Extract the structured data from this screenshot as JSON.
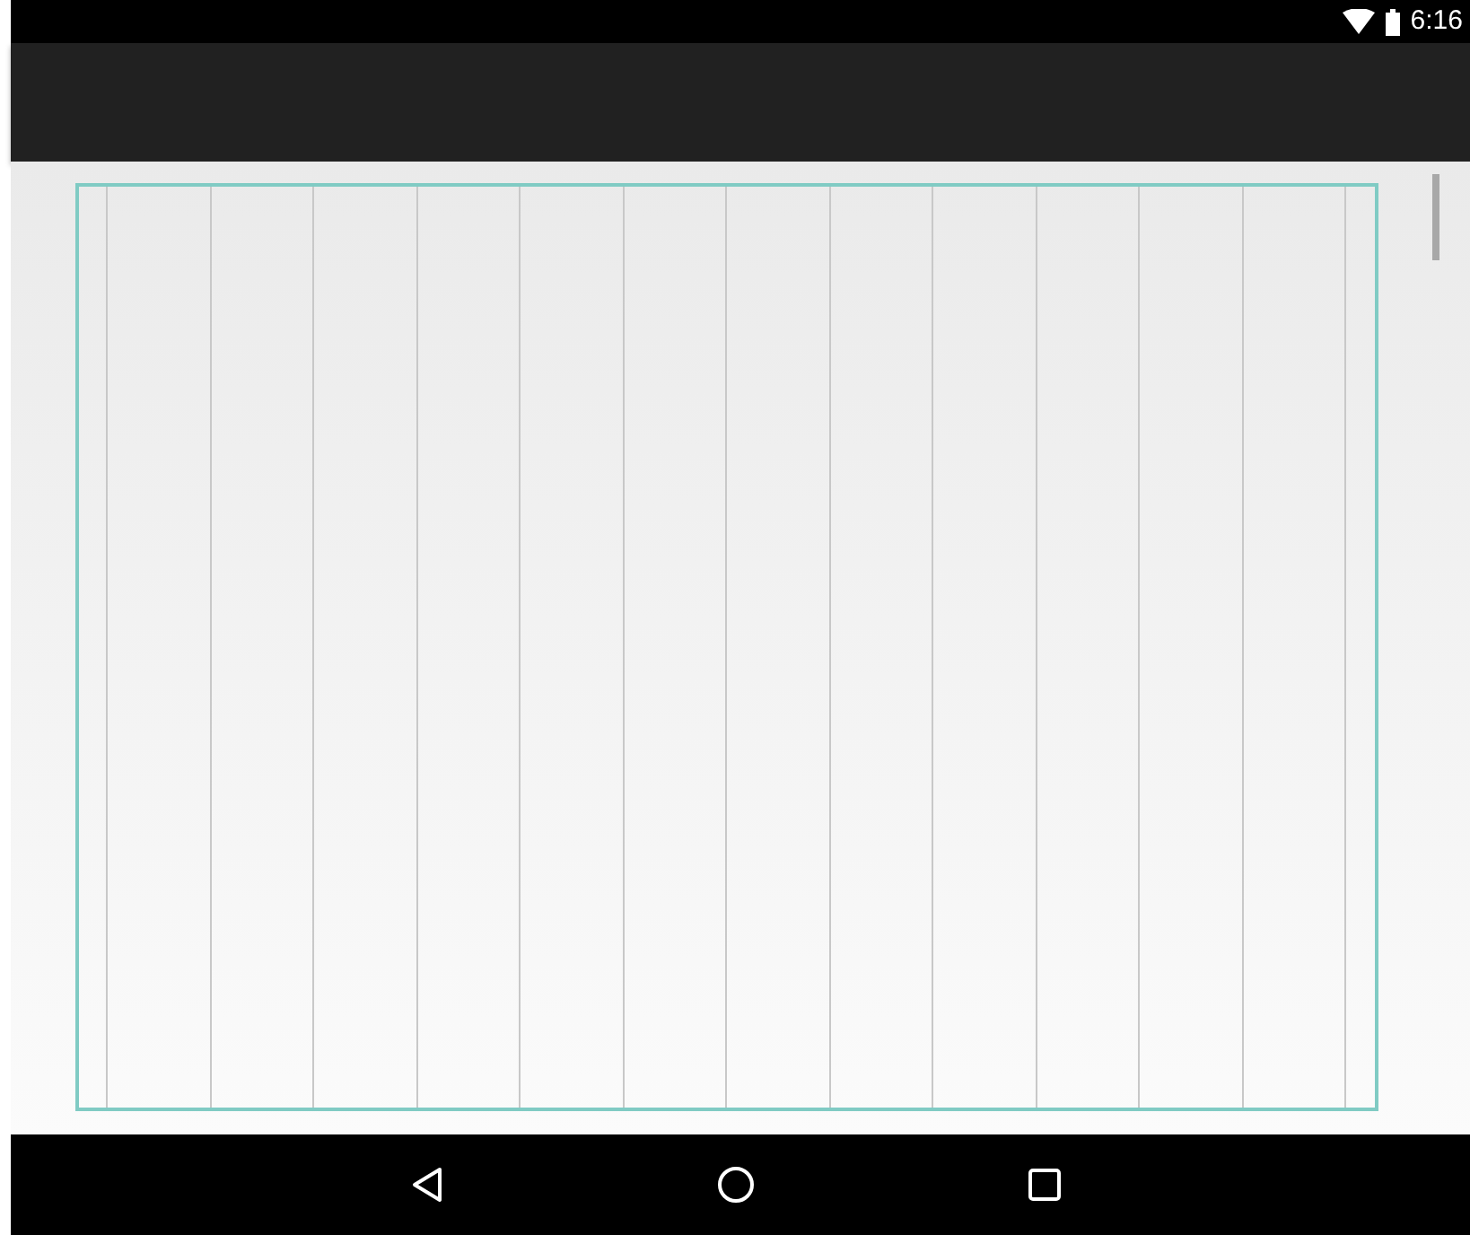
{
  "status_bar": {
    "time": "6:16"
  }
}
